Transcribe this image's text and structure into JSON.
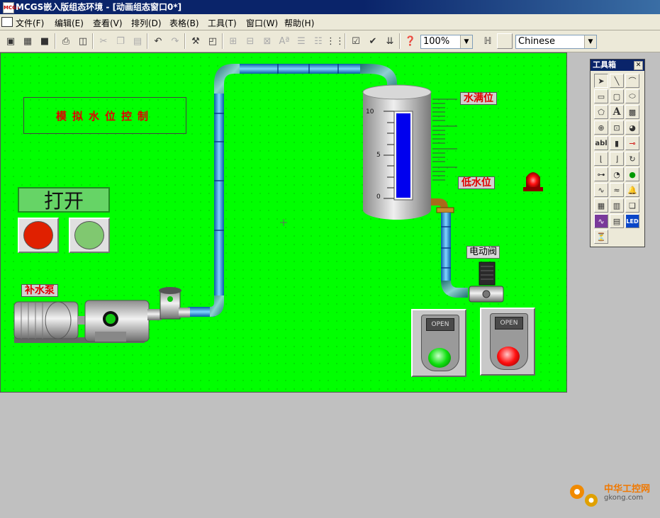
{
  "window": {
    "title": "MCGS嵌入版组态环境 - [动画组态窗口0*]"
  },
  "menu": [
    {
      "label": "文件(F)"
    },
    {
      "label": "编辑(E)"
    },
    {
      "label": "查看(V)"
    },
    {
      "label": "排列(D)"
    },
    {
      "label": "表格(B)"
    },
    {
      "label": "工具(T)"
    },
    {
      "label": "窗口(W)"
    },
    {
      "label": "帮助(H)"
    }
  ],
  "toolbar": {
    "zoom_value": "100%",
    "language_value": "Chinese",
    "icons": [
      "window-icon",
      "blocks-icon",
      "save-icon",
      "print-icon",
      "print-preview-icon",
      "cut-icon",
      "copy-icon",
      "paste-icon",
      "undo-icon",
      "redo-icon",
      "tools-icon",
      "window-layout-icon",
      "align-icon",
      "font-icon",
      "text-size-icon",
      "grid-icon",
      "properties-icon",
      "check-icon",
      "step-icon",
      "help-icon",
      "language-icon"
    ]
  },
  "canvas": {
    "title_text": "模拟水位控制",
    "open_label": "打开",
    "pump_label": "补水泵",
    "high_level_label": "水满位",
    "low_level_label": "低水位",
    "valve_label": "电动阀",
    "tank_scale": [
      "10",
      "5",
      "0"
    ],
    "open_button_1_tag": "OPEN",
    "open_button_2_tag": "OPEN",
    "colors": {
      "background": "#00ff00",
      "level_bar": "#0000ee",
      "alarm": "#e00000"
    }
  },
  "toolbox": {
    "title": "工具箱",
    "text_tool_label": "A",
    "label_tool": "abl",
    "led_tool": "LED",
    "tools": [
      "pointer",
      "line",
      "arc",
      "rectangle",
      "rounded-rectangle",
      "ellipse",
      "polygon",
      "text",
      "bitmap",
      "insert-element",
      "save-element",
      "flowline",
      "label",
      "input-box",
      "slider",
      "pipe",
      "flow",
      "rotate",
      "meter",
      "dial",
      "indicator",
      "trend",
      "history-trend",
      "alarm",
      "table",
      "custom-table",
      "stock",
      "chart",
      "report",
      "led",
      "clock"
    ]
  },
  "watermark": {
    "name": "中华工控网",
    "url": "gkong.com"
  }
}
